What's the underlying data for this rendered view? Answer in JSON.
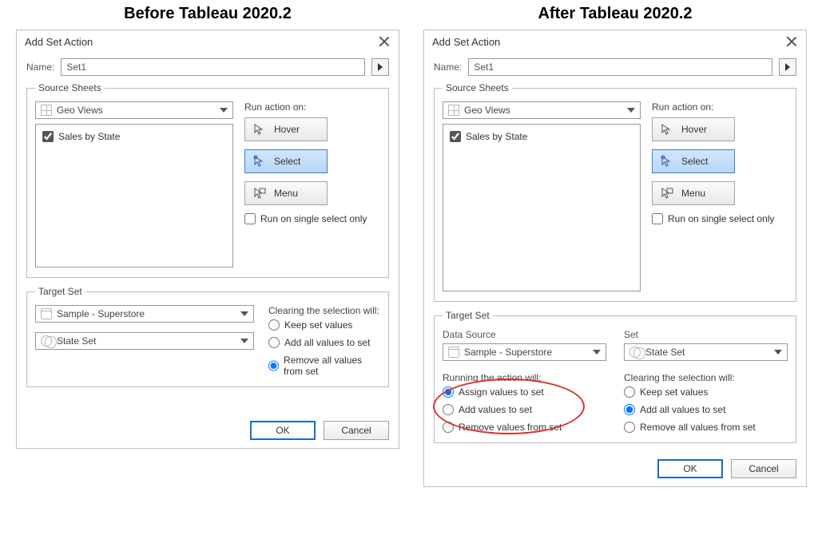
{
  "titles": {
    "before": "Before Tableau 2020.2",
    "after": "After Tableau 2020.2"
  },
  "dialog_title": "Add Set Action",
  "name_label": "Name:",
  "name_value": "Set1",
  "source_sheets_legend": "Source Sheets",
  "sheet_select": "Geo Views",
  "sheet_item": "Sales by State",
  "run_action_label": "Run action on:",
  "run_buttons": {
    "hover": "Hover",
    "select": "Select",
    "menu": "Menu"
  },
  "single_select_label": "Run on single select only",
  "target_set_legend": "Target Set",
  "before": {
    "datasource": "Sample - Superstore",
    "set": "State Set",
    "clearing_label": "Clearing the selection will:",
    "clearing_options": [
      "Keep set values",
      "Add all values to set",
      "Remove all values from set"
    ]
  },
  "after": {
    "datasource_label": "Data Source",
    "set_label": "Set",
    "datasource": "Sample - Superstore",
    "set": "State Set",
    "running_label": "Running the action will:",
    "running_options": [
      "Assign values to set",
      "Add values to set",
      "Remove values from set"
    ],
    "clearing_label": "Clearing the selection will:",
    "clearing_options": [
      "Keep set values",
      "Add all values to set",
      "Remove all values from set"
    ]
  },
  "buttons": {
    "ok": "OK",
    "cancel": "Cancel"
  }
}
